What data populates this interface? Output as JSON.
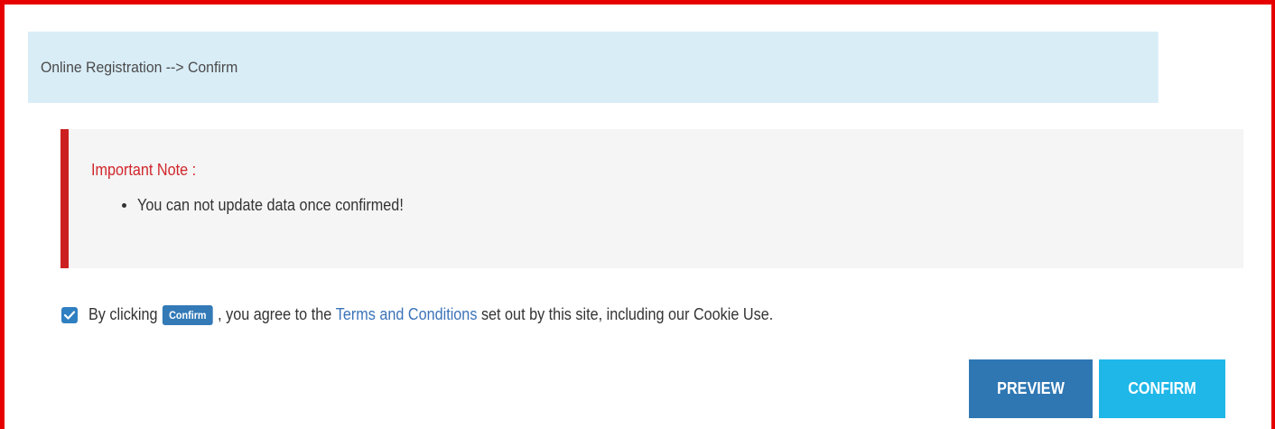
{
  "breadcrumb": {
    "text": "Online Registration --> Confirm"
  },
  "note": {
    "title": "Important Note :",
    "items": [
      "You can not update data once confirmed!"
    ]
  },
  "agreement": {
    "checked": true,
    "prefix": "By clicking",
    "badge_label": "Confirm",
    "middle": ", you agree to the",
    "link_label": "Terms and Conditions",
    "suffix": "set out by this site, including our Cookie Use."
  },
  "actions": {
    "preview_label": "PREVIEW",
    "confirm_label": "CONFIRM"
  },
  "colors": {
    "frame": "#e60000",
    "heading_bg": "#d9edf7",
    "note_accent": "#cc1f1f",
    "note_title": "#d0262b",
    "primary": "#2f77b3",
    "info": "#1fb7e8",
    "link": "#3b73b9"
  }
}
